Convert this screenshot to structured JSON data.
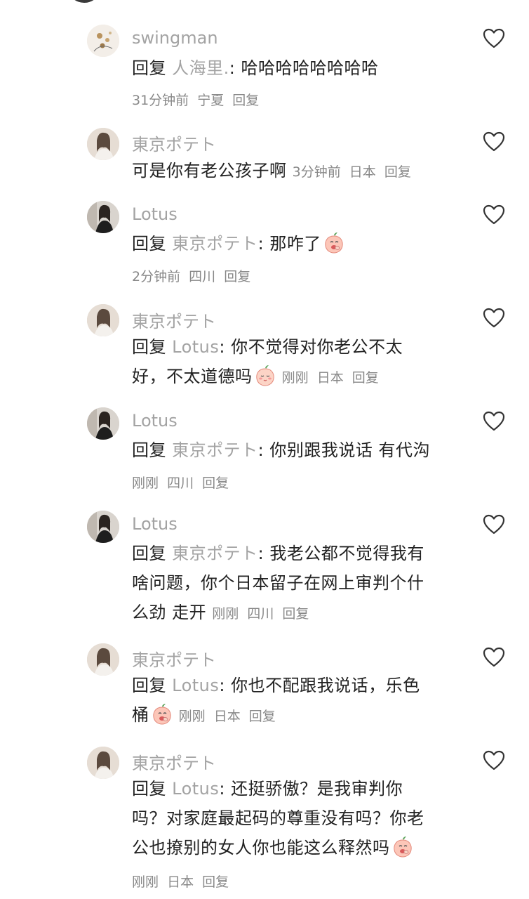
{
  "comments": [
    {
      "author": "swingman",
      "reply_prefix": "回复",
      "reply_to": "人海里.",
      "text": ": 哈哈哈哈哈哈哈哈",
      "time": "31分钟前",
      "location": "宁夏",
      "reply_label": "回复",
      "avatar": "avatar-flower"
    },
    {
      "author": "東京ポテト",
      "text": "可是你有老公孩子啊",
      "time": "3分钟前",
      "location": "日本",
      "reply_label": "回复",
      "avatar": "avatar-girl-light"
    },
    {
      "author": "Lotus",
      "reply_prefix": "回复",
      "reply_to": "東京ポテト",
      "text": ": 那咋了",
      "emoji": "peach-mocking-emoji",
      "time": "2分钟前",
      "location": "四川",
      "reply_label": "回复",
      "avatar": "avatar-girl-dark"
    },
    {
      "author": "東京ポテト",
      "reply_prefix": "回复",
      "reply_to": "Lotus",
      "text_line1": ": 你不觉得对你老公不太",
      "text_line2": "好，不太道德吗",
      "emoji": "blushing-emoji",
      "time": "刚刚",
      "location": "日本",
      "reply_label": "回复",
      "avatar": "avatar-girl-light"
    },
    {
      "author": "Lotus",
      "reply_prefix": "回复",
      "reply_to": "東京ポテト",
      "text": ": 你别跟我说话 有代沟",
      "time": "刚刚",
      "location": "四川",
      "reply_label": "回复",
      "avatar": "avatar-girl-dark"
    },
    {
      "author": "Lotus",
      "reply_prefix": "回复",
      "reply_to": "東京ポテト",
      "text_line1": ": 我老公都不觉得我有",
      "text_line2": "啥问题，你个日本留子在网上审判个什",
      "text_line3": "么劲 走开",
      "time": "刚刚",
      "location": "四川",
      "reply_label": "回复",
      "avatar": "avatar-girl-dark"
    },
    {
      "author": "東京ポテト",
      "reply_prefix": "回复",
      "reply_to": "Lotus",
      "text_line1": ": 你也不配跟我说话，乐色",
      "text_line2": "桶",
      "emoji": "peach-mocking-emoji",
      "time": "刚刚",
      "location": "日本",
      "reply_label": "回复",
      "avatar": "avatar-girl-light"
    },
    {
      "author": "東京ポテト",
      "reply_prefix": "回复",
      "reply_to": "Lotus",
      "text_line1": ": 还挺骄傲？是我审判你",
      "text_line2": "吗？对家庭最起码的尊重没有吗？你老",
      "text_line3": "公也撩别的女人你也能这么释然吗",
      "emoji": "peach-mocking-emoji",
      "time": "刚刚",
      "location": "日本",
      "reply_label": "回复",
      "avatar": "avatar-girl-light"
    }
  ],
  "colors": {
    "name": "#a3a3a3",
    "text": "#222222",
    "meta": "#888888",
    "heart_stroke": "#333333"
  },
  "icons": {
    "like": "heart-outline-icon"
  }
}
